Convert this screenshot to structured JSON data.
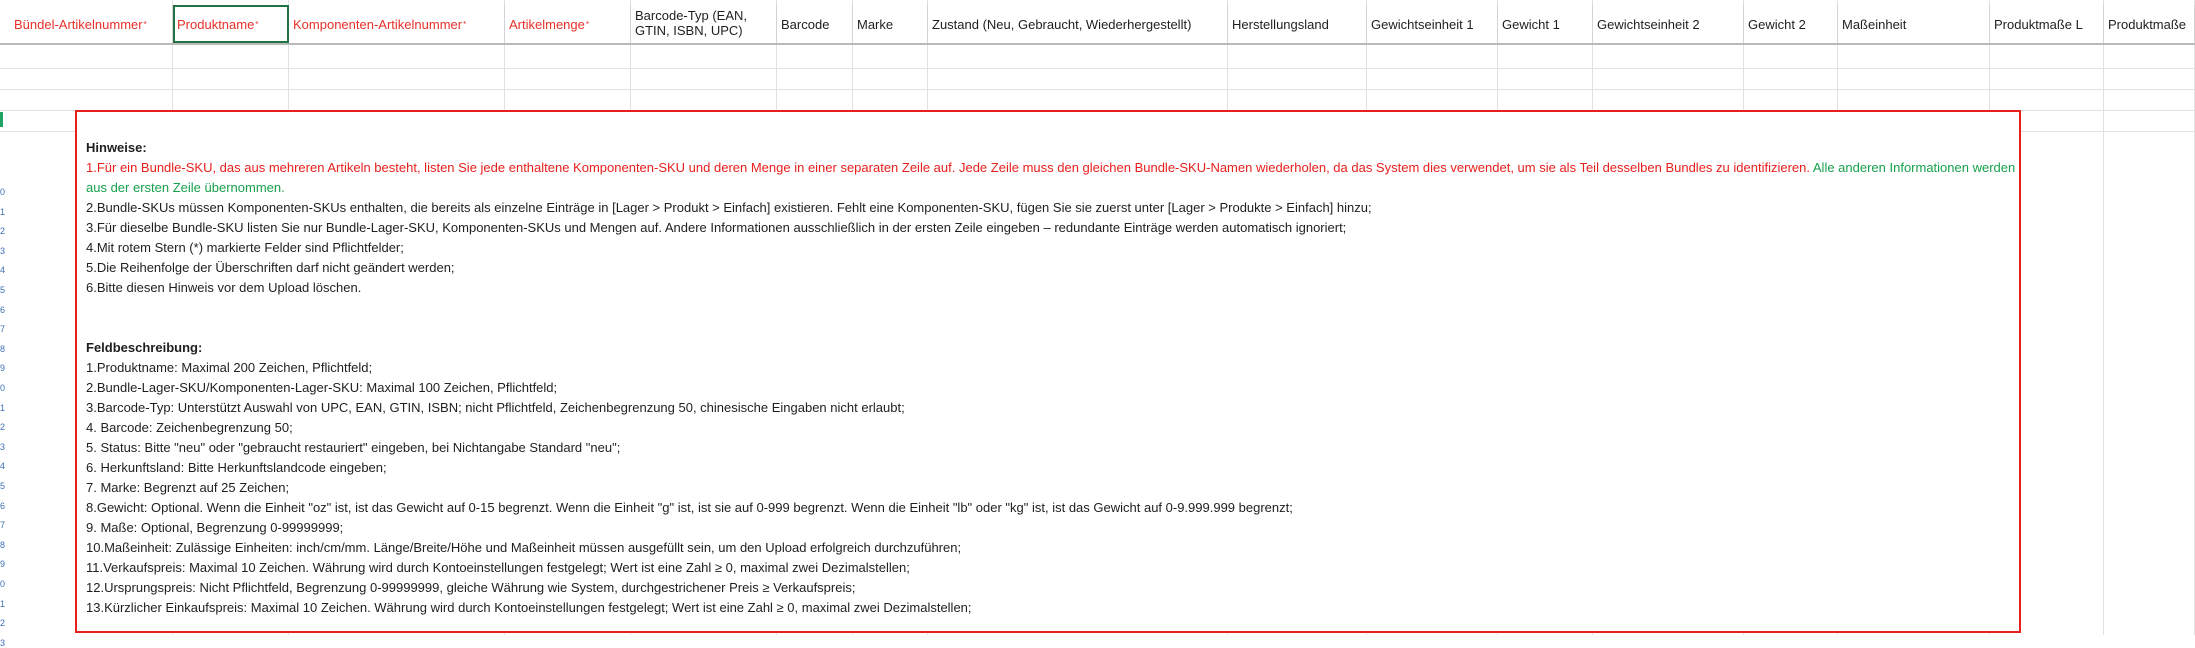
{
  "header": {
    "columns": [
      {
        "label": "Bündel-Artikelnummer",
        "required": true
      },
      {
        "label": "Produktname",
        "required": true
      },
      {
        "label": "Komponenten-Artikelnummer",
        "required": true
      },
      {
        "label": "Artikelmenge",
        "required": true
      },
      {
        "label": "Barcode-Typ (EAN, GTIN, ISBN, UPC)",
        "required": false
      },
      {
        "label": "Barcode",
        "required": false
      },
      {
        "label": "Marke",
        "required": false
      },
      {
        "label": "Zustand (Neu, Gebraucht, Wiederhergestellt)",
        "required": false
      },
      {
        "label": "Herstellungsland",
        "required": false
      },
      {
        "label": "Gewichtseinheit 1",
        "required": false
      },
      {
        "label": "Gewicht 1",
        "required": false
      },
      {
        "label": "Gewichtseinheit 2",
        "required": false
      },
      {
        "label": "Gewicht 2",
        "required": false
      },
      {
        "label": "Maßeinheit",
        "required": false
      },
      {
        "label": "Produktmaße L",
        "required": false
      },
      {
        "label": "Produktmaße",
        "required": false
      }
    ],
    "required_marker": "*"
  },
  "row_numbers": [
    "0",
    "1",
    "2",
    "3",
    "4",
    "5",
    "6",
    "7",
    "8",
    "9",
    "0",
    "1",
    "2",
    "3",
    "4",
    "5",
    "6",
    "7",
    "8",
    "9",
    "0",
    "1",
    "2",
    "3"
  ],
  "notes": {
    "title": "Hinweise:",
    "item1_red": "1.Für ein Bundle-SKU, das aus mehreren Artikeln besteht, listen Sie jede enthaltene Komponenten-SKU und deren Menge in einer separaten Zeile auf. Jede Zeile muss den gleichen Bundle-SKU-Namen wiederholen, da das System dies verwendet, um sie als Teil desselben Bundles zu identifizieren.",
    "item1_green": " Alle anderen Informationen werden aus der ersten Zeile übernommen.",
    "items": [
      "2.Bundle-SKUs müssen Komponenten-SKUs enthalten, die bereits als einzelne Einträge in [Lager > Produkt > Einfach] existieren. Fehlt eine Komponenten-SKU, fügen Sie sie zuerst unter [Lager > Produkte > Einfach] hinzu;",
      "3.Für dieselbe Bundle-SKU listen Sie nur Bundle-Lager-SKU, Komponenten-SKUs und Mengen auf. Andere Informationen ausschließlich in der ersten Zeile eingeben – redundante Einträge werden automatisch ignoriert;",
      "4.Mit rotem Stern (*) markierte Felder sind Pflichtfelder;",
      "5.Die Reihenfolge der Überschriften darf nicht geändert werden;",
      "6.Bitte diesen Hinweis vor dem Upload löschen."
    ],
    "field_title": "Feldbeschreibung:",
    "fields": [
      "1.Produktname: Maximal 200 Zeichen, Pflichtfeld;",
      "2.Bundle-Lager-SKU/Komponenten-Lager-SKU: Maximal 100 Zeichen, Pflichtfeld;",
      "3.Barcode-Typ: Unterstützt Auswahl von UPC, EAN, GTIN, ISBN; nicht Pflichtfeld, Zeichenbegrenzung 50, chinesische Eingaben nicht erlaubt;",
      "4. Barcode: Zeichenbegrenzung 50;",
      "5. Status: Bitte \"neu\" oder \"gebraucht restauriert\" eingeben, bei Nichtangabe Standard \"neu\";",
      "6. Herkunftsland: Bitte Herkunftslandcode eingeben;",
      "7. Marke: Begrenzt auf 25 Zeichen;",
      "8.Gewicht: Optional. Wenn die Einheit \"oz\" ist, ist das Gewicht auf 0-15 begrenzt. Wenn die Einheit \"g\" ist, ist sie auf 0-999 begrenzt. Wenn die Einheit \"lb\" oder \"kg\" ist, ist das Gewicht auf 0-9.999.999 begrenzt;",
      "9. Maße: Optional, Begrenzung 0-99999999;",
      "10.Maßeinheit: Zulässige Einheiten: inch/cm/mm. Länge/Breite/Höhe und Maßeinheit müssen ausgefüllt sein, um den Upload erfolgreich durchzuführen;",
      "11.Verkaufspreis: Maximal 10 Zeichen. Währung wird durch Kontoeinstellungen festgelegt; Wert ist eine Zahl ≥ 0, maximal zwei Dezimalstellen;",
      "12.Ursprungspreis: Nicht Pflichtfeld, Begrenzung 0-99999999, gleiche Währung wie System, durchgestrichener Preis ≥ Verkaufspreis;",
      "13.Kürzlicher Einkaufspreis: Maximal 10 Zeichen. Währung wird durch Kontoeinstellungen festgelegt; Wert ist eine Zahl ≥ 0, maximal zwei Dezimalstellen;"
    ]
  },
  "colors": {
    "required_header": "#e8302a",
    "notes_border": "#e8201d",
    "notes_green": "#17a14c",
    "selection": "#217346"
  }
}
